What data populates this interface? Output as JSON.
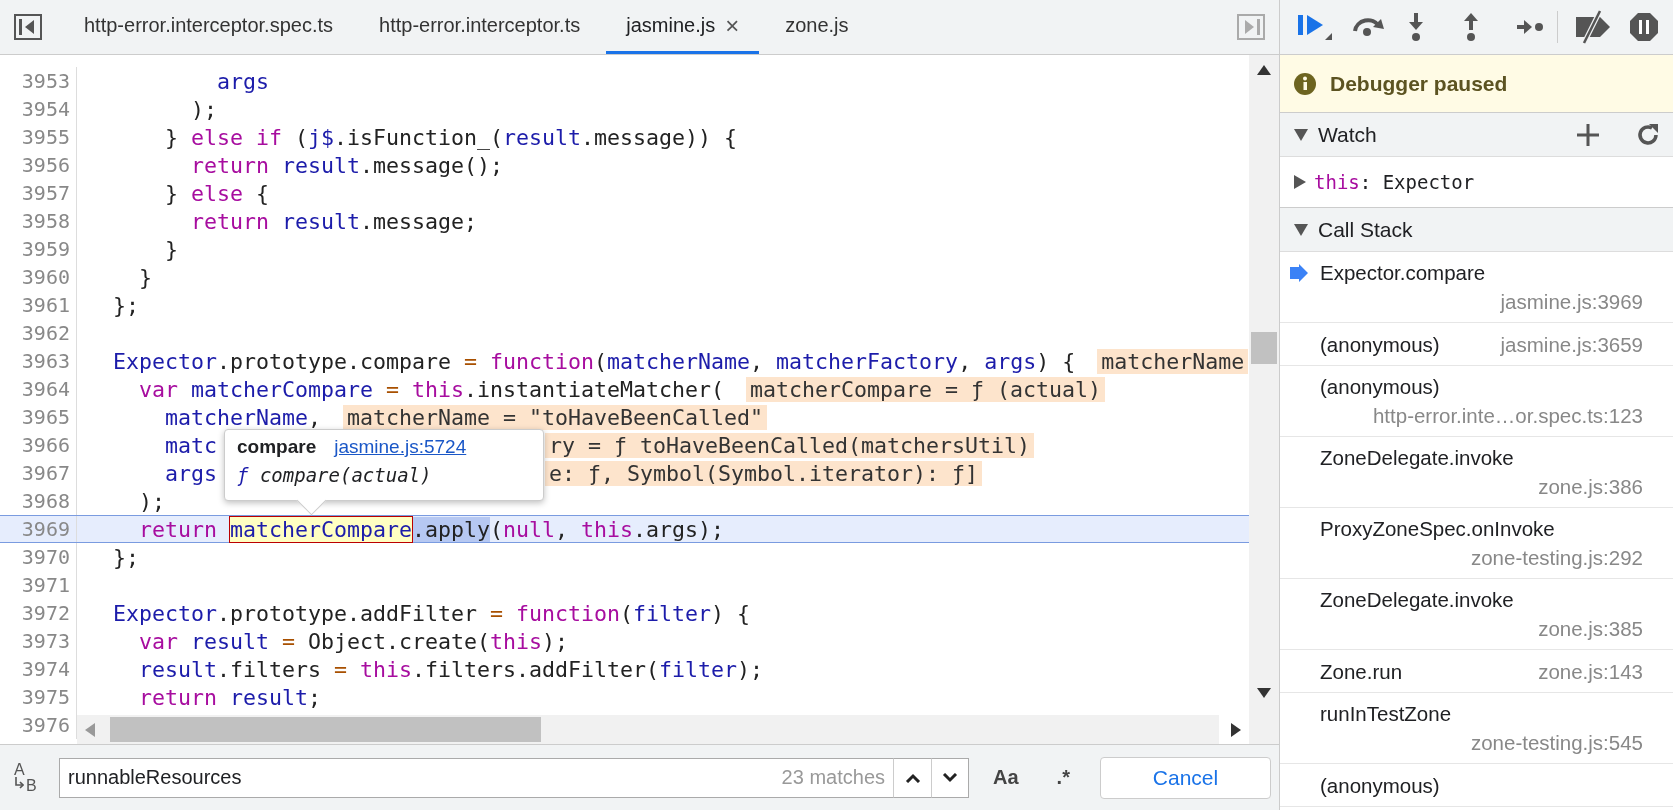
{
  "tabs": [
    {
      "label": "http-error.interceptor.spec.ts",
      "selected": false
    },
    {
      "label": "http-error.interceptor.ts",
      "selected": false
    },
    {
      "label": "jasmine.js",
      "selected": true,
      "close": "×"
    },
    {
      "label": "zone.js",
      "selected": false
    }
  ],
  "editor": {
    "lines": [
      {
        "number": "3953",
        "tokens": [
          {
            "text": "        args",
            "kind": "var"
          }
        ]
      },
      {
        "number": "3954",
        "tokens": [
          {
            "text": "      );",
            "kind": "plain"
          }
        ]
      },
      {
        "number": "3955",
        "tokens": [
          {
            "text": "    } ",
            "kind": "plain"
          },
          {
            "text": "else if",
            "kind": "kw"
          },
          {
            "text": " (",
            "kind": "plain"
          },
          {
            "text": "j$",
            "kind": "var"
          },
          {
            "text": ".isFunction_(",
            "kind": "plain"
          },
          {
            "text": "result",
            "kind": "var"
          },
          {
            "text": ".message)) {",
            "kind": "plain"
          }
        ]
      },
      {
        "number": "3956",
        "tokens": [
          {
            "text": "      return",
            "kind": "kw"
          },
          {
            "text": " result",
            "kind": "var"
          },
          {
            "text": ".message();",
            "kind": "plain"
          }
        ]
      },
      {
        "number": "3957",
        "tokens": [
          {
            "text": "    } ",
            "kind": "plain"
          },
          {
            "text": "else",
            "kind": "kw"
          },
          {
            "text": " {",
            "kind": "plain"
          }
        ]
      },
      {
        "number": "3958",
        "tokens": [
          {
            "text": "      return",
            "kind": "kw"
          },
          {
            "text": " result",
            "kind": "var"
          },
          {
            "text": ".message;",
            "kind": "plain"
          }
        ]
      },
      {
        "number": "3959",
        "tokens": [
          {
            "text": "    }",
            "kind": "plain"
          }
        ]
      },
      {
        "number": "3960",
        "tokens": [
          {
            "text": "  }",
            "kind": "plain"
          }
        ]
      },
      {
        "number": "3961",
        "tokens": [
          {
            "text": "};",
            "kind": "plain"
          }
        ]
      },
      {
        "number": "3962"
      },
      {
        "number": "3963",
        "tokens": [
          {
            "text": "Expector",
            "kind": "var"
          },
          {
            "text": ".prototype.compare ",
            "kind": "plain"
          },
          {
            "text": "=",
            "kind": "op"
          },
          {
            "text": " function",
            "kind": "kw"
          },
          {
            "text": "(",
            "kind": "plain"
          },
          {
            "text": "matcherName",
            "kind": "var"
          },
          {
            "text": ", ",
            "kind": "plain"
          },
          {
            "text": "matcherFactory",
            "kind": "var"
          },
          {
            "text": ", ",
            "kind": "plain"
          },
          {
            "text": "args",
            "kind": "var"
          },
          {
            "text": ") {",
            "kind": "plain"
          }
        ],
        "inline_value": "matcherName"
      },
      {
        "number": "3964",
        "tokens": [
          {
            "text": "  var",
            "kind": "kw"
          },
          {
            "text": " matcherCompare",
            "kind": "var"
          },
          {
            "text": " =",
            "kind": "op"
          },
          {
            "text": " this",
            "kind": "kw"
          },
          {
            "text": ".instantiateMatcher(",
            "kind": "plain"
          }
        ],
        "inline_value": "matcherCompare = ƒ (actual)"
      },
      {
        "number": "3965",
        "tokens": [
          {
            "text": "    matcherName",
            "kind": "var"
          },
          {
            "text": ",",
            "kind": "plain"
          }
        ],
        "inline_value": "matcherName = \"toHaveBeenCalled\""
      },
      {
        "number": "3966",
        "tokens": [
          {
            "text": "    matc",
            "kind": "var"
          }
        ],
        "inline_value": "ry = ƒ toHaveBeenCalled(matchersUtil)",
        "under_popover": true
      },
      {
        "number": "3967",
        "tokens": [
          {
            "text": "    args",
            "kind": "var"
          }
        ],
        "inline_value": "e: ƒ, Symbol(Symbol.iterator): ƒ]",
        "under_popover": true
      },
      {
        "number": "3968",
        "tokens": [
          {
            "text": "  );",
            "kind": "plain"
          }
        ]
      },
      {
        "number": "3969",
        "current": true,
        "tokens": [
          {
            "text": "  return ",
            "kind": "kw"
          },
          {
            "text": "matcherCompare",
            "kind": "hovered"
          },
          {
            "text": ".apply",
            "kind": "selected"
          },
          {
            "text": "(",
            "kind": "plain"
          },
          {
            "text": "null",
            "kind": "kw"
          },
          {
            "text": ", ",
            "kind": "plain"
          },
          {
            "text": "this",
            "kind": "kw"
          },
          {
            "text": ".args);",
            "kind": "plain"
          }
        ]
      },
      {
        "number": "3970",
        "tokens": [
          {
            "text": "};",
            "kind": "plain"
          }
        ]
      },
      {
        "number": "3971"
      },
      {
        "number": "3972",
        "tokens": [
          {
            "text": "Expector",
            "kind": "var"
          },
          {
            "text": ".prototype.addFilter ",
            "kind": "plain"
          },
          {
            "text": "=",
            "kind": "op"
          },
          {
            "text": " function",
            "kind": "kw"
          },
          {
            "text": "(",
            "kind": "plain"
          },
          {
            "text": "filter",
            "kind": "var"
          },
          {
            "text": ") {",
            "kind": "plain"
          }
        ]
      },
      {
        "number": "3973",
        "tokens": [
          {
            "text": "  var",
            "kind": "kw"
          },
          {
            "text": " result",
            "kind": "var"
          },
          {
            "text": " =",
            "kind": "op"
          },
          {
            "text": " Object.create(",
            "kind": "plain"
          },
          {
            "text": "this",
            "kind": "kw"
          },
          {
            "text": ");",
            "kind": "plain"
          }
        ]
      },
      {
        "number": "3974",
        "tokens": [
          {
            "text": "  result",
            "kind": "var"
          },
          {
            "text": ".filters ",
            "kind": "plain"
          },
          {
            "text": "=",
            "kind": "op"
          },
          {
            "text": " this",
            "kind": "kw"
          },
          {
            "text": ".filters.addFilter(",
            "kind": "plain"
          },
          {
            "text": "filter",
            "kind": "var"
          },
          {
            "text": ");",
            "kind": "plain"
          }
        ]
      },
      {
        "number": "3975",
        "tokens": [
          {
            "text": "  return",
            "kind": "kw"
          },
          {
            "text": " result",
            "kind": "var"
          },
          {
            "text": ";",
            "kind": "plain"
          }
        ]
      },
      {
        "number": "3976"
      }
    ],
    "popover": {
      "title": "compare",
      "link": "jasmine.js:5724",
      "prefix": "ƒ",
      "signature": "compare(actual)"
    }
  },
  "search": {
    "replace_toggle": {
      "top": "A",
      "bottom": "B"
    },
    "value": "runnableResources",
    "count": "23 matches",
    "case_button": "Aa",
    "regex_button": ".*",
    "cancel": "Cancel"
  },
  "debugger": {
    "banner": "Debugger paused",
    "watch": {
      "title": "Watch",
      "expanded": true,
      "items": [
        {
          "name": "this",
          "separator": ":",
          "value": "Expector",
          "expanded": false
        }
      ]
    },
    "call_stack": {
      "title": "Call Stack",
      "expanded": true,
      "frames": [
        {
          "name": "Expector.compare",
          "location": "jasmine.js:3969",
          "selected": true
        },
        {
          "name": "(anonymous)",
          "location": "jasmine.js:3659",
          "selected": false
        },
        {
          "name": "(anonymous)",
          "location": "http-error.inte…or.spec.ts:123",
          "selected": false
        },
        {
          "name": "ZoneDelegate.invoke",
          "location": "zone.js:386",
          "selected": false
        },
        {
          "name": "ProxyZoneSpec.onInvoke",
          "location": "zone-testing.js:292",
          "selected": false
        },
        {
          "name": "ZoneDelegate.invoke",
          "location": "zone.js:385",
          "selected": false
        },
        {
          "name": "Zone.run",
          "location": "zone.js:143",
          "selected": false
        },
        {
          "name": "runInTestZone",
          "location": "zone-testing.js:545",
          "selected": false
        },
        {
          "name": "(anonymous)",
          "selected": false
        }
      ]
    }
  }
}
